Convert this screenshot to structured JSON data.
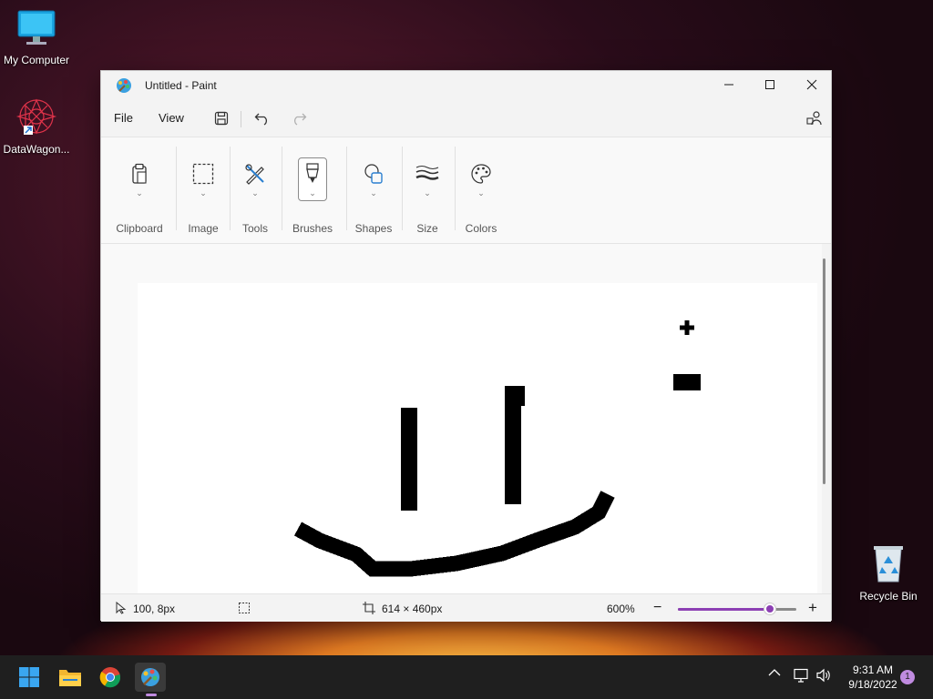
{
  "desktop": {
    "icons": [
      {
        "label": "My Computer"
      },
      {
        "label": "DataWagon..."
      },
      {
        "label": "Recycle Bin"
      }
    ]
  },
  "window": {
    "title": "Untitled - Paint"
  },
  "menu": {
    "file": "File",
    "view": "View"
  },
  "ribbon": {
    "groups": [
      {
        "label": "Clipboard",
        "icon": "clipboard-icon"
      },
      {
        "label": "Image",
        "icon": "selection-icon"
      },
      {
        "label": "Tools",
        "icon": "tools-icon"
      },
      {
        "label": "Brushes",
        "icon": "brush-icon"
      },
      {
        "label": "Shapes",
        "icon": "shapes-icon"
      },
      {
        "label": "Size",
        "icon": "size-icon"
      },
      {
        "label": "Colors",
        "icon": "palette-icon"
      }
    ]
  },
  "status": {
    "cursor_position": "100, 8px",
    "canvas_size": "614 × 460px",
    "zoom": "600%",
    "zoom_level_fraction": 0.78
  },
  "taskbar": {
    "time": "9:31 AM",
    "date": "9/18/2022",
    "notification_count": "1"
  },
  "colors": {
    "accent": "#8c3fb3",
    "taskbar": "#1f1f1f"
  }
}
